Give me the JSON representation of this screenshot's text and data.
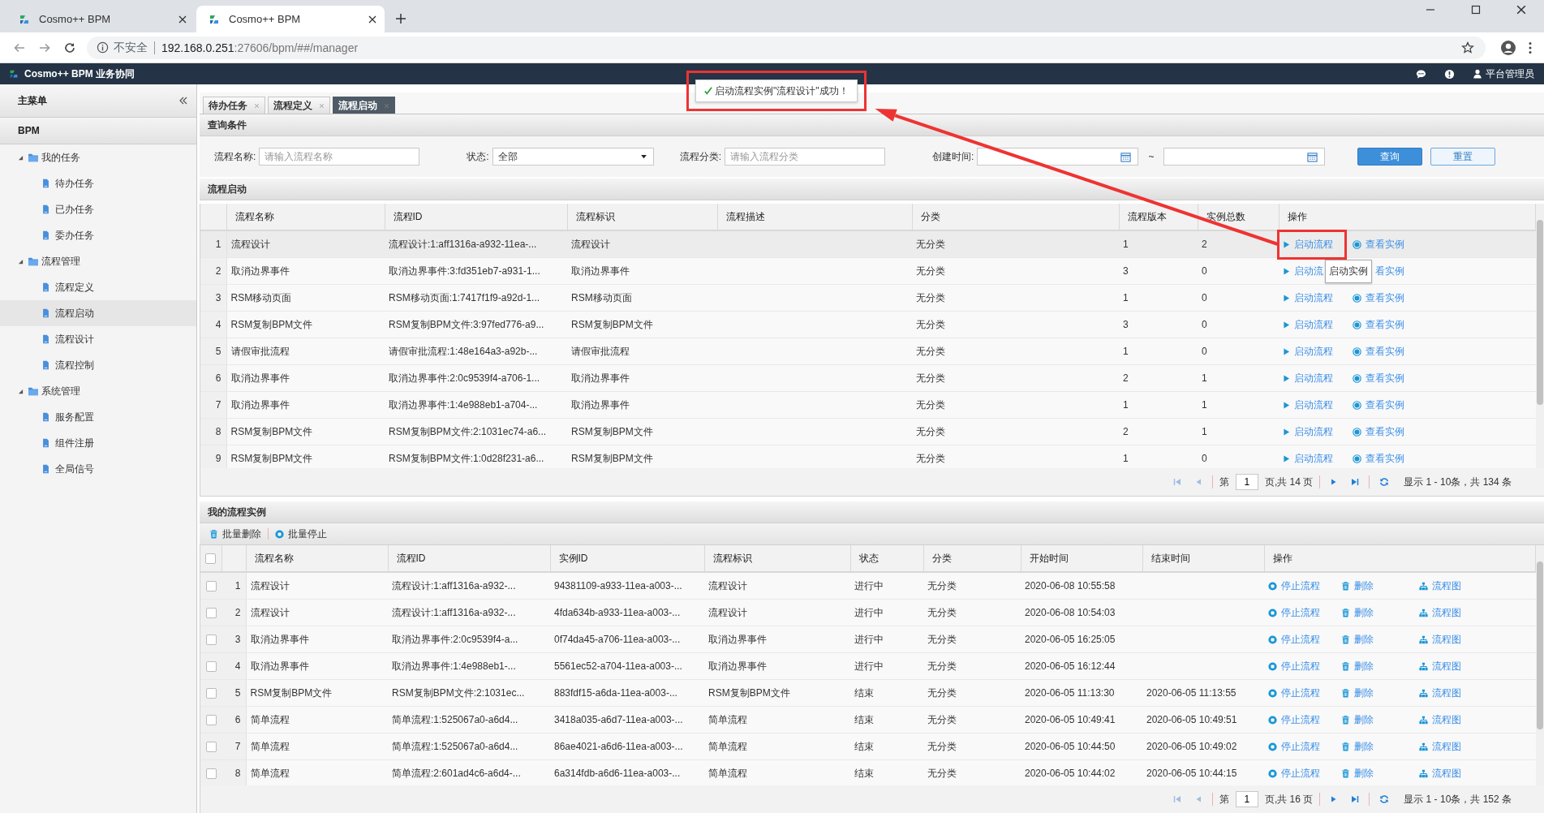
{
  "browser": {
    "tabs": [
      {
        "title": "Cosmo++ BPM",
        "selected": false
      },
      {
        "title": "Cosmo++ BPM",
        "selected": true
      }
    ],
    "security": "不安全",
    "url_host": "192.168.0.251",
    "url_rest": ":27606/bpm/##/manager"
  },
  "app_header": {
    "title": "Cosmo++ BPM 业务协同",
    "user": "平台管理员"
  },
  "toast": {
    "message": "启动流程实例\"流程设计\"成功！"
  },
  "sidebar": {
    "title": "主菜单",
    "section": "BPM",
    "items": [
      {
        "label": "我的任务",
        "expanded": true,
        "children": [
          {
            "label": "待办任务",
            "selected": false
          },
          {
            "label": "已办任务",
            "selected": false
          },
          {
            "label": "委办任务",
            "selected": false
          }
        ]
      },
      {
        "label": "流程管理",
        "expanded": true,
        "children": [
          {
            "label": "流程定义",
            "selected": false
          },
          {
            "label": "流程启动",
            "selected": true
          },
          {
            "label": "流程设计",
            "selected": false
          },
          {
            "label": "流程控制",
            "selected": false
          }
        ]
      },
      {
        "label": "系统管理",
        "expanded": true,
        "children": [
          {
            "label": "服务配置",
            "selected": false
          },
          {
            "label": "组件注册",
            "selected": false
          },
          {
            "label": "全局信号",
            "selected": false
          }
        ]
      }
    ]
  },
  "tabs": [
    {
      "label": "待办任务",
      "selected": false
    },
    {
      "label": "流程定义",
      "selected": false
    },
    {
      "label": "流程启动",
      "selected": true
    }
  ],
  "query": {
    "title": "查询条件",
    "fields": [
      {
        "kind": "text",
        "label": "流程名称:",
        "placeholder": "请输入流程名称"
      },
      {
        "kind": "select",
        "label": "状态:",
        "value": "全部"
      },
      {
        "kind": "text",
        "label": "流程分类:",
        "placeholder": "请输入流程分类"
      },
      {
        "kind": "daterange",
        "label": "创建时间:",
        "separator": "~"
      }
    ],
    "buttons": [
      {
        "kind": "primary",
        "label": "查询"
      },
      {
        "kind": "secondary",
        "label": "重置"
      }
    ]
  },
  "process_table": {
    "title": "流程启动",
    "columns": [
      "流程名称",
      "流程ID",
      "流程标识",
      "流程描述",
      "分类",
      "流程版本",
      "实例总数",
      "操作"
    ],
    "rows": [
      {
        "num": "1",
        "selected": true,
        "name": "流程设计",
        "id": "流程设计:1:aff1316a-a932-11ea-...",
        "key": "流程设计",
        "category": "无分类",
        "version": "1",
        "instances": "2",
        "actions": [
          {
            "kind": "start",
            "label": "启动流程"
          },
          {
            "kind": "view",
            "label": "查看实例"
          }
        ]
      },
      {
        "num": "2",
        "selected": false,
        "name": "取消边界事件",
        "id": "取消边界事件:3:fd351eb7-a931-1...",
        "key": "取消边界事件",
        "category": "无分类",
        "version": "3",
        "instances": "0",
        "actions": [
          {
            "kind": "start",
            "label": "启动流"
          },
          {
            "kind": "view",
            "label": "看实例"
          }
        ]
      },
      {
        "num": "3",
        "selected": false,
        "name": "RSM移动页面",
        "id": "RSM移动页面:1:7417f1f9-a92d-1...",
        "key": "RSM移动页面",
        "category": "无分类",
        "version": "1",
        "instances": "0",
        "actions": [
          {
            "kind": "start",
            "label": "启动流程"
          },
          {
            "kind": "view",
            "label": "查看实例"
          }
        ]
      },
      {
        "num": "4",
        "selected": false,
        "name": "RSM复制BPM文件",
        "id": "RSM复制BPM文件:3:97fed776-a9...",
        "key": "RSM复制BPM文件",
        "category": "无分类",
        "version": "3",
        "instances": "0",
        "actions": [
          {
            "kind": "start",
            "label": "启动流程"
          },
          {
            "kind": "view",
            "label": "查看实例"
          }
        ]
      },
      {
        "num": "5",
        "selected": false,
        "name": "请假审批流程",
        "id": "请假审批流程:1:48e164a3-a92b-...",
        "key": "请假审批流程",
        "category": "无分类",
        "version": "1",
        "instances": "0",
        "actions": [
          {
            "kind": "start",
            "label": "启动流程"
          },
          {
            "kind": "view",
            "label": "查看实例"
          }
        ]
      },
      {
        "num": "6",
        "selected": false,
        "name": "取消边界事件",
        "id": "取消边界事件:2:0c9539f4-a706-1...",
        "key": "取消边界事件",
        "category": "无分类",
        "version": "2",
        "instances": "1",
        "actions": [
          {
            "kind": "start",
            "label": "启动流程"
          },
          {
            "kind": "view",
            "label": "查看实例"
          }
        ]
      },
      {
        "num": "7",
        "selected": false,
        "name": "取消边界事件",
        "id": "取消边界事件:1:4e988eb1-a704-...",
        "key": "取消边界事件",
        "category": "无分类",
        "version": "1",
        "instances": "1",
        "actions": [
          {
            "kind": "start",
            "label": "启动流程"
          },
          {
            "kind": "view",
            "label": "查看实例"
          }
        ]
      },
      {
        "num": "8",
        "selected": false,
        "name": "RSM复制BPM文件",
        "id": "RSM复制BPM文件:2:1031ec74-a6...",
        "key": "RSM复制BPM文件",
        "category": "无分类",
        "version": "2",
        "instances": "1",
        "actions": [
          {
            "kind": "start",
            "label": "启动流程"
          },
          {
            "kind": "view",
            "label": "查看实例"
          }
        ]
      },
      {
        "num": "9",
        "selected": false,
        "name": "RSM复制BPM文件",
        "id": "RSM复制BPM文件:1:0d28f231-a6...",
        "key": "RSM复制BPM文件",
        "category": "无分类",
        "version": "1",
        "instances": "0",
        "actions": [
          {
            "kind": "start",
            "label": "启动流程"
          },
          {
            "kind": "view",
            "label": "查看实例"
          }
        ]
      }
    ],
    "tooltip": "启动实例",
    "pager": {
      "before": "第",
      "page": "1",
      "after": "页,共 14 页",
      "summary": "显示 1 - 10条，共 134 条"
    }
  },
  "instance_table": {
    "title": "我的流程实例",
    "toolbar": [
      {
        "kind": "delete",
        "label": "批量删除"
      },
      {
        "kind": "stop",
        "label": "批量停止"
      }
    ],
    "all_checked": false,
    "columns": [
      "流程名称",
      "流程ID",
      "实例ID",
      "流程标识",
      "状态",
      "分类",
      "开始时间",
      "结束时间",
      "操作"
    ],
    "rows": [
      {
        "num": "1",
        "checked": false,
        "name": "流程设计",
        "id": "流程设计:1:aff1316a-a932-...",
        "instance": "94381109-a933-11ea-a003-...",
        "key": "流程设计",
        "status": "进行中",
        "category": "无分类",
        "start": "2020-06-08 10:55:58",
        "actions": [
          {
            "kind": "stop",
            "label": "停止流程"
          },
          {
            "kind": "delete",
            "label": "删除"
          },
          {
            "kind": "diagram",
            "label": "流程图"
          }
        ]
      },
      {
        "num": "2",
        "checked": false,
        "name": "流程设计",
        "id": "流程设计:1:aff1316a-a932-...",
        "instance": "4fda634b-a933-11ea-a003-...",
        "key": "流程设计",
        "status": "进行中",
        "category": "无分类",
        "start": "2020-06-08 10:54:03",
        "actions": [
          {
            "kind": "stop",
            "label": "停止流程"
          },
          {
            "kind": "delete",
            "label": "删除"
          },
          {
            "kind": "diagram",
            "label": "流程图"
          }
        ]
      },
      {
        "num": "3",
        "checked": false,
        "name": "取消边界事件",
        "id": "取消边界事件:2:0c9539f4-a...",
        "instance": "0f74da45-a706-11ea-a003-...",
        "key": "取消边界事件",
        "status": "进行中",
        "category": "无分类",
        "start": "2020-06-05 16:25:05",
        "actions": [
          {
            "kind": "stop",
            "label": "停止流程"
          },
          {
            "kind": "delete",
            "label": "删除"
          },
          {
            "kind": "diagram",
            "label": "流程图"
          }
        ]
      },
      {
        "num": "4",
        "checked": false,
        "name": "取消边界事件",
        "id": "取消边界事件:1:4e988eb1-...",
        "instance": "5561ec52-a704-11ea-a003-...",
        "key": "取消边界事件",
        "status": "进行中",
        "category": "无分类",
        "start": "2020-06-05 16:12:44",
        "actions": [
          {
            "kind": "stop",
            "label": "停止流程"
          },
          {
            "kind": "delete",
            "label": "删除"
          },
          {
            "kind": "diagram",
            "label": "流程图"
          }
        ]
      },
      {
        "num": "5",
        "checked": false,
        "name": "RSM复制BPM文件",
        "id": "RSM复制BPM文件:2:1031ec...",
        "instance": "883fdf15-a6da-11ea-a003-...",
        "key": "RSM复制BPM文件",
        "status": "结束",
        "category": "无分类",
        "start": "2020-06-05 11:13:30",
        "end": "2020-06-05 11:13:55",
        "actions": [
          {
            "kind": "stop",
            "label": "停止流程"
          },
          {
            "kind": "delete",
            "label": "删除"
          },
          {
            "kind": "diagram",
            "label": "流程图"
          }
        ]
      },
      {
        "num": "6",
        "checked": false,
        "name": "简单流程",
        "id": "简单流程:1:525067a0-a6d4...",
        "instance": "3418a035-a6d7-11ea-a003-...",
        "key": "简单流程",
        "status": "结束",
        "category": "无分类",
        "start": "2020-06-05 10:49:41",
        "end": "2020-06-05 10:49:51",
        "actions": [
          {
            "kind": "stop",
            "label": "停止流程"
          },
          {
            "kind": "delete",
            "label": "删除"
          },
          {
            "kind": "diagram",
            "label": "流程图"
          }
        ]
      },
      {
        "num": "7",
        "checked": false,
        "name": "简单流程",
        "id": "简单流程:1:525067a0-a6d4...",
        "instance": "86ae4021-a6d6-11ea-a003-...",
        "key": "简单流程",
        "status": "结束",
        "category": "无分类",
        "start": "2020-06-05 10:44:50",
        "end": "2020-06-05 10:49:02",
        "actions": [
          {
            "kind": "stop",
            "label": "停止流程"
          },
          {
            "kind": "delete",
            "label": "删除"
          },
          {
            "kind": "diagram",
            "label": "流程图"
          }
        ]
      },
      {
        "num": "8",
        "checked": false,
        "name": "简单流程",
        "id": "简单流程:2:601ad4c6-a6d4-...",
        "instance": "6a314fdb-a6d6-11ea-a003-...",
        "key": "简单流程",
        "status": "结束",
        "category": "无分类",
        "start": "2020-06-05 10:44:02",
        "end": "2020-06-05 10:44:15",
        "actions": [
          {
            "kind": "stop",
            "label": "停止流程"
          },
          {
            "kind": "delete",
            "label": "删除"
          },
          {
            "kind": "diagram",
            "label": "流程图"
          }
        ]
      }
    ],
    "pager": {
      "before": "第",
      "page": "1",
      "after": "页,共 16 页",
      "summary": "显示 1 - 10条，共 152 条"
    }
  }
}
